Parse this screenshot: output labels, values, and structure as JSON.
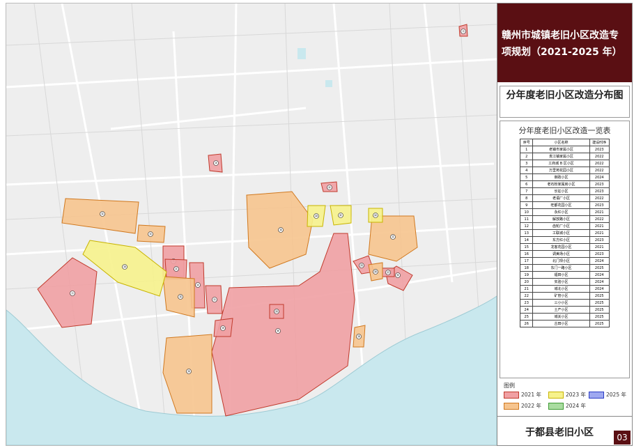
{
  "title": "赣州市城镇老旧小区改造专项规划（2021-2025 年）",
  "subtitle": "分年度老旧小区改造分布图",
  "table": {
    "title": "分年度老旧小区改造一览表",
    "headers": [
      "序号",
      "小区名称",
      "建设时序"
    ],
    "rows": [
      [
        "1",
        "老镇市家属小区",
        "2023"
      ],
      [
        "2",
        "贡江镇家属小区",
        "2022"
      ],
      [
        "3",
        "工商城 B 区小区",
        "2022"
      ],
      [
        "4",
        "万里苑花园小区",
        "2022"
      ],
      [
        "5",
        "御政小区",
        "2024"
      ],
      [
        "6",
        "老石粉家属房小区",
        "2023"
      ],
      [
        "7",
        "长征小区",
        "2023"
      ],
      [
        "8",
        "老语厂小区",
        "2022"
      ],
      [
        "9",
        "旺都花园小区",
        "2023"
      ],
      [
        "10",
        "永红小区",
        "2021"
      ],
      [
        "11",
        "解放路小区",
        "2022"
      ],
      [
        "12",
        "齿轮厂小区",
        "2021"
      ],
      [
        "13",
        "工联城小区",
        "2021"
      ],
      [
        "14",
        "东方红小区",
        "2023"
      ],
      [
        "15",
        "龙客花园小区",
        "2021"
      ],
      [
        "16",
        "调美场小区",
        "2023"
      ],
      [
        "17",
        "北门坝小区",
        "2024"
      ],
      [
        "18",
        "东门一路小区",
        "2025"
      ],
      [
        "19",
        "福田小区",
        "2024"
      ],
      [
        "20",
        "实验小区",
        "2024"
      ],
      [
        "21",
        "城北小区",
        "2024"
      ],
      [
        "22",
        "矿管小区",
        "2025"
      ],
      [
        "23",
        "三小小区",
        "2025"
      ],
      [
        "24",
        "土产小区",
        "2025"
      ],
      [
        "25",
        "城关小区",
        "2025"
      ],
      [
        "26",
        "古田小区",
        "2025"
      ]
    ]
  },
  "legend": {
    "title": "图例",
    "items": [
      {
        "label": "2021 年",
        "fill": "#f0a0a3",
        "stroke": "#c0392b"
      },
      {
        "label": "2023 年",
        "fill": "#f6f28c",
        "stroke": "#c8b400"
      },
      {
        "label": "2025 年",
        "fill": "#9ea8f0",
        "stroke": "#2a3cc4"
      },
      {
        "label": "2022 年",
        "fill": "#f6c48e",
        "stroke": "#d0781e"
      },
      {
        "label": "2024 年",
        "fill": "#a9dca0",
        "stroke": "#3e9a33"
      }
    ]
  },
  "footer": {
    "title": "于都县老旧小区",
    "page": "03"
  },
  "colors": {
    "brand": "#5a0f13",
    "water": "#c9e8ee",
    "y2021": "#f0a0a3",
    "y2022": "#f6c48e",
    "y2023": "#f6f28c"
  },
  "map": {
    "zones": [
      {
        "year": "2021",
        "label": "①"
      },
      {
        "year": "2021",
        "label": "②"
      },
      {
        "year": "2021",
        "label": "③"
      },
      {
        "year": "2021",
        "label": "④"
      },
      {
        "year": "2021",
        "label": "⑤"
      },
      {
        "year": "2021",
        "label": "⑥"
      },
      {
        "year": "2021",
        "label": "⑦"
      },
      {
        "year": "2021",
        "label": "⑧"
      },
      {
        "year": "2021",
        "label": "⑨"
      },
      {
        "year": "2021",
        "label": "⑩"
      },
      {
        "year": "2021",
        "label": "⑪"
      },
      {
        "year": "2022",
        "label": "⑫"
      },
      {
        "year": "2022",
        "label": "⑬"
      },
      {
        "year": "2022",
        "label": "⑭"
      },
      {
        "year": "2022",
        "label": "⑮"
      },
      {
        "year": "2022",
        "label": "⑯"
      },
      {
        "year": "2022",
        "label": "⑰"
      },
      {
        "year": "2022",
        "label": "⑱"
      },
      {
        "year": "2023",
        "label": "⑲"
      },
      {
        "year": "2023",
        "label": "⑳"
      },
      {
        "year": "2023",
        "label": "㉑"
      },
      {
        "year": "2023",
        "label": "㉒"
      },
      {
        "year": "2021",
        "label": "㉓"
      },
      {
        "year": "2021",
        "label": "㉔"
      },
      {
        "year": "2021",
        "label": "㉕"
      },
      {
        "year": "2022",
        "label": "㉖"
      }
    ]
  }
}
